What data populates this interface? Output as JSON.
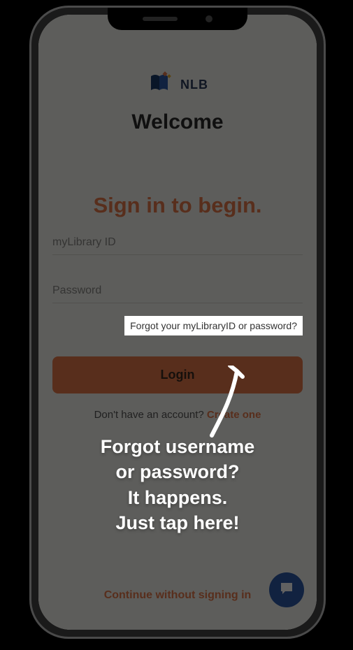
{
  "logo": {
    "name": "NLB"
  },
  "welcome": "Welcome",
  "signin_heading": "Sign in to begin.",
  "fields": {
    "username_label": "myLibrary ID",
    "password_label": "Password"
  },
  "forgot_link": "Forgot your myLibraryID or password?",
  "login_button": "Login",
  "no_account_prefix": "Don't have an account? ",
  "no_account_action": "Create one",
  "continue_link": "Continue without signing in",
  "annotation": {
    "line1": "Forgot username",
    "line2": "or password?",
    "line3": "It happens.",
    "line4": "Just tap here!"
  }
}
